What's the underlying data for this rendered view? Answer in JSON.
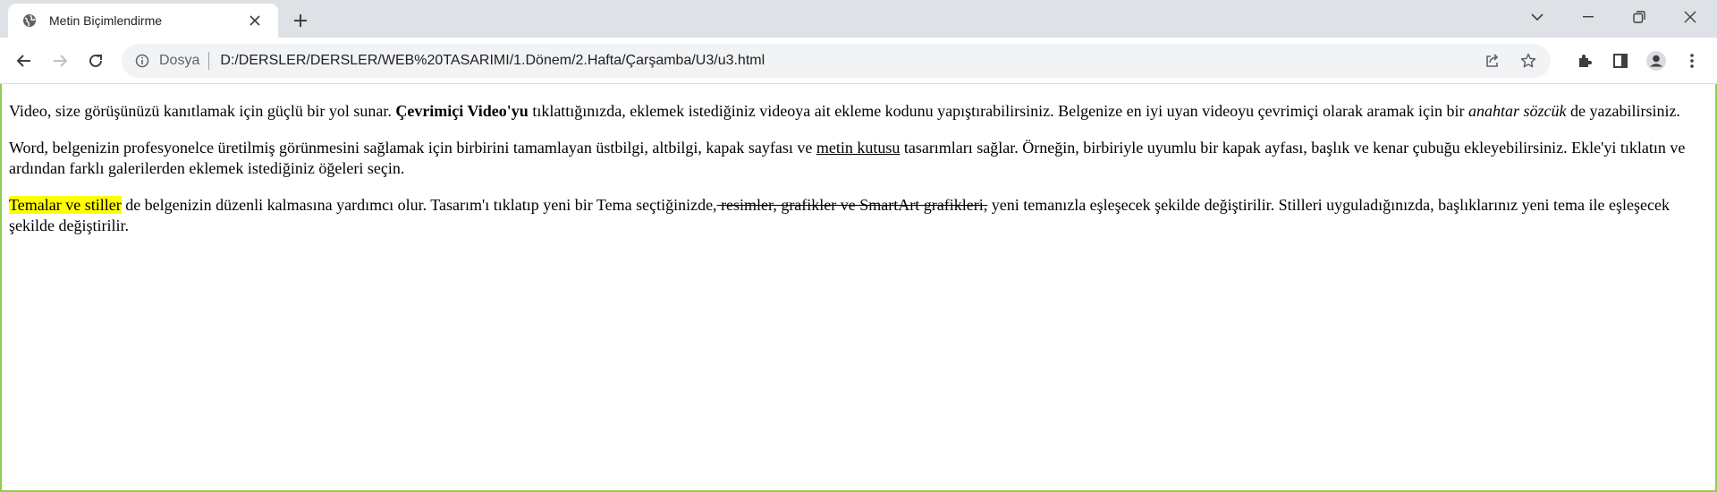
{
  "tab": {
    "title": "Metin Biçimlendirme",
    "favicon": "globe-icon"
  },
  "omnibox": {
    "scheme_label": "Dosya",
    "url": "D:/DERSLER/DERSLER/WEB%20TASARIMI/1.Dönem/2.Hafta/Çarşamba/U3/u3.html"
  },
  "theme": {
    "frame_accent": "#8fce4e",
    "tabstrip_bg": "#dee1e6",
    "highlight": "#ffff00"
  },
  "content": {
    "p1": {
      "s1": "Video, size görüşünüzü kanıtlamak için güçlü bir yol sunar. ",
      "bold": "Çevrimiçi Video'yu",
      "s2": " tıklattığınızda, eklemek istediğiniz videoya ait ekleme kodunu yapıştırabilirsiniz. Belgenize en iyi uyan videoyu çevrimiçi olarak aramak için bir ",
      "italic": "anahtar sözcük",
      "s3": " de yazabilirsiniz."
    },
    "p2": {
      "s1": "Word, belgenizin profesyonelce üretilmiş görünmesini sağlamak için birbirini tamamlayan üstbilgi, altbilgi, kapak sayfası ve ",
      "underline": "metin kutusu",
      "s2": " tasarımları sağlar. Örneğin, birbiriyle uyumlu bir kapak ayfası, başlık ve kenar çubuğu ekleyebilirsiniz. Ekle'yi tıklatın ve ardından farklı galerilerden eklemek istediğiniz öğeleri seçin."
    },
    "p3": {
      "highlight": "Temalar ve stiller",
      "s1": " de belgenizin düzenli kalmasına yardımcı olur. Tasarım'ı tıklatıp yeni bir Tema seçtiğinizde,",
      "strike": " resimler, grafikler ve SmartArt grafikleri,",
      "s2": " yeni temanızla eşleşecek şekilde değiştirilir. Stilleri uyguladığınızda, başlıklarınız yeni tema ile eşleşecek şekilde değiştirilir."
    }
  }
}
